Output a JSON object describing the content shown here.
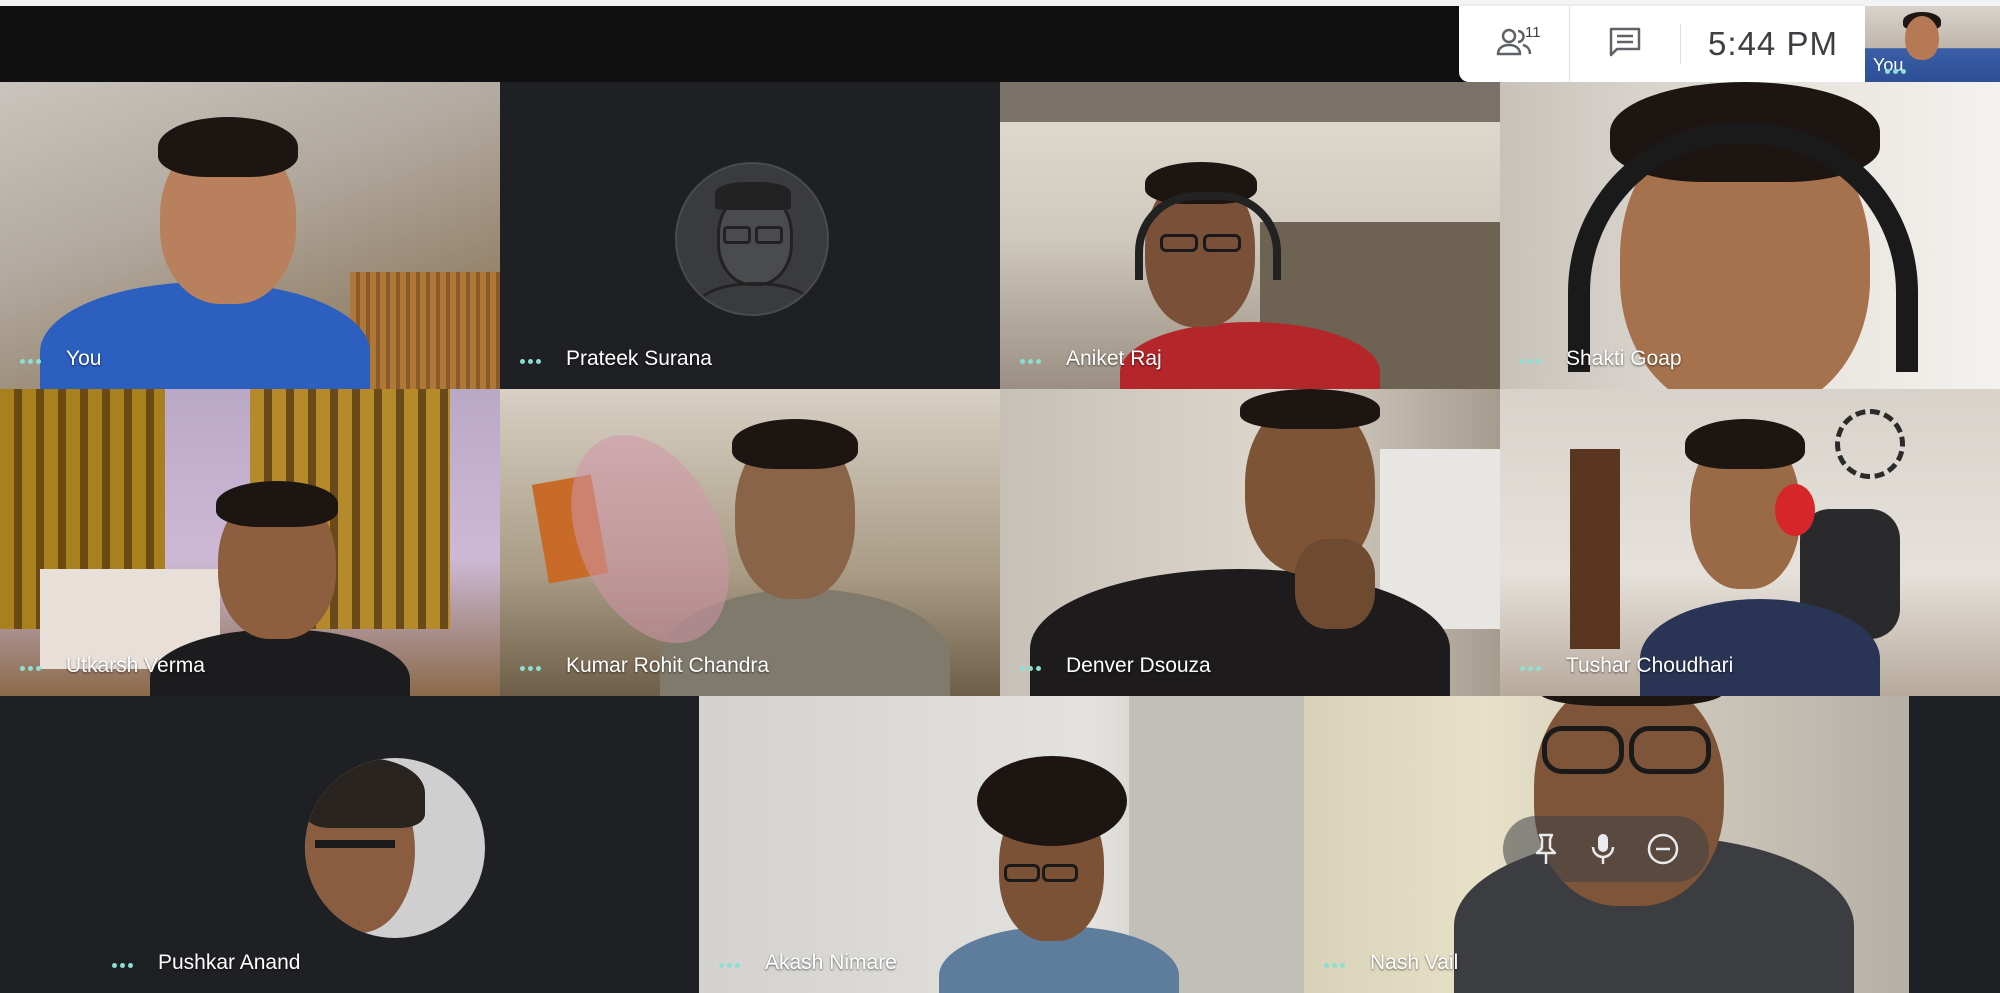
{
  "header": {
    "participants_count": "11",
    "time": "5:44 PM",
    "self_label": "You"
  },
  "tiles": [
    {
      "name": "You"
    },
    {
      "name": "Prateek Surana"
    },
    {
      "name": "Aniket Raj"
    },
    {
      "name": "Shakti Goap"
    },
    {
      "name": "Utkarsh Verma"
    },
    {
      "name": "Kumar Rohit Chandra"
    },
    {
      "name": "Denver Dsouza"
    },
    {
      "name": "Tushar Choudhari"
    },
    {
      "name": "Pushkar Anand"
    },
    {
      "name": "Akash Nimare"
    },
    {
      "name": "Nash Vail"
    }
  ],
  "icons": {
    "people": "people-icon",
    "chat": "chat-icon",
    "pin": "pin-icon",
    "mic": "mic-icon",
    "remove": "remove-icon",
    "more": "more-options-icon"
  },
  "colors": {
    "dots": "#8be0d4",
    "panel_bg": "#ffffff",
    "empty_tile_bg": "#1f2023"
  }
}
